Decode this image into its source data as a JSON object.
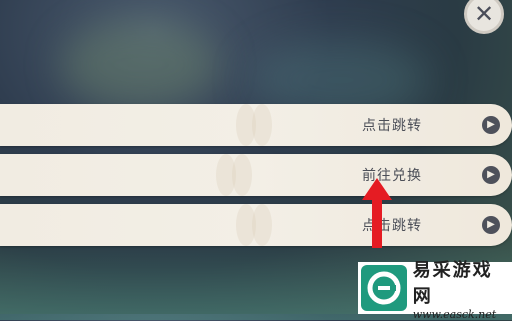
{
  "close_icon": "close-icon",
  "rows": [
    {
      "label": "点击跳转",
      "icon": "chevron-right-icon"
    },
    {
      "label": "前往兑换",
      "icon": "chevron-right-icon"
    },
    {
      "label": "点击跳转",
      "icon": "chevron-right-icon"
    }
  ],
  "colors": {
    "row_bg": "#f1ece2",
    "label": "#4c4f58",
    "arrow_btn": "#4e515b",
    "annotation_arrow": "#e51c23",
    "watermark_logo": "#1f9a7e"
  },
  "watermark": {
    "title": "易采游戏网",
    "url": "www.easck.net"
  }
}
